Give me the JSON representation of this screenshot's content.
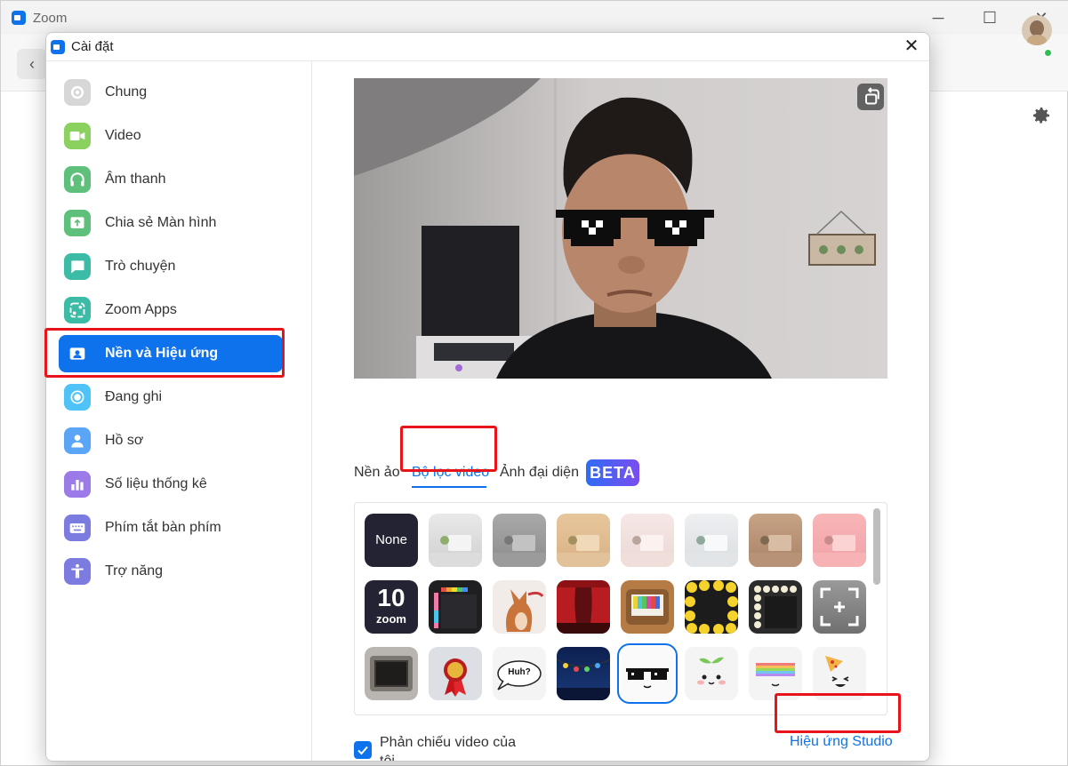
{
  "main_window": {
    "title": "Zoom",
    "back_glyph": "‹",
    "minimize_glyph": "─",
    "maximize_glyph": "☐",
    "close_glyph": "✕"
  },
  "dialog": {
    "title": "Cài đặt",
    "close_glyph": "✕"
  },
  "sidebar": {
    "items": [
      {
        "label": "Chung",
        "icon": "gear-icon",
        "color": "#cfcfcf"
      },
      {
        "label": "Video",
        "icon": "video-camera-icon",
        "color": "#8bd15f"
      },
      {
        "label": "Âm thanh",
        "icon": "headphones-icon",
        "color": "#5ec07a"
      },
      {
        "label": "Chia sẻ Màn hình",
        "icon": "share-screen-icon",
        "color": "#5ec07a"
      },
      {
        "label": "Trò chuyện",
        "icon": "chat-icon",
        "color": "#3cbba6"
      },
      {
        "label": "Zoom Apps",
        "icon": "zoom-apps-icon",
        "color": "#3cbba6"
      },
      {
        "label": "Nền và Hiệu ứng",
        "icon": "background-icon",
        "color": "#0e72ed",
        "active": true
      },
      {
        "label": "Đang ghi",
        "icon": "record-icon",
        "color": "#4fc3f7"
      },
      {
        "label": "Hồ sơ",
        "icon": "profile-icon",
        "color": "#5aa5f5"
      },
      {
        "label": "Số liệu thống kê",
        "icon": "statistics-icon",
        "color": "#9c7ae8"
      },
      {
        "label": "Phím tắt bàn phím",
        "icon": "keyboard-icon",
        "color": "#7c7ce0"
      },
      {
        "label": "Trợ năng",
        "icon": "accessibility-icon",
        "color": "#7c7ce0"
      }
    ]
  },
  "tabs": {
    "virtual_bg": "Nền ảo",
    "video_filters": "Bộ lọc video",
    "avatars": "Ảnh đại diện",
    "beta": "BETA"
  },
  "filters": {
    "none_label": "None",
    "zoom10_label": "10",
    "zoom_word": "zoom",
    "huh_label": "Huh?",
    "selected_index": 20
  },
  "footer": {
    "mirror_label": "Phản chiếu video của tôi",
    "mirror_checked": true,
    "studio_link": "Hiệu ứng Studio"
  },
  "colors": {
    "accent": "#0e72ed",
    "highlight": "#e8141a"
  }
}
